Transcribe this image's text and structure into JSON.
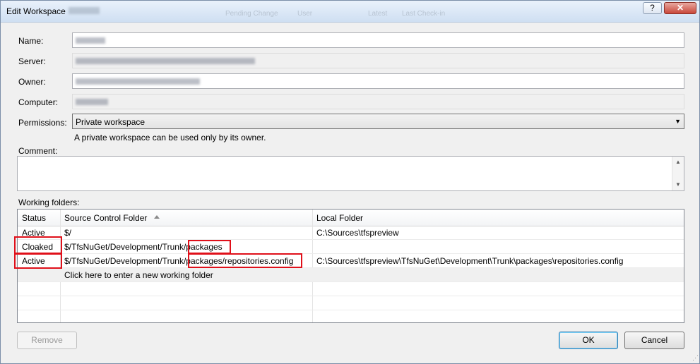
{
  "window": {
    "title": "Edit Workspace",
    "help_label": "?",
    "close_label": "✕",
    "bg_tabs": [
      "Pending Change",
      "User",
      "Latest",
      "Last Check-in"
    ]
  },
  "labels": {
    "name": "Name:",
    "server": "Server:",
    "owner": "Owner:",
    "computer": "Computer:",
    "permissions": "Permissions:",
    "comment": "Comment:",
    "working_folders": "Working folders:"
  },
  "permissions": {
    "value": "Private workspace",
    "hint": "A private workspace can be used only by its owner.",
    "arrow": "▼"
  },
  "grid": {
    "columns": [
      "Status",
      "Source Control Folder",
      "Local Folder"
    ],
    "rows": [
      {
        "status": "Active",
        "source_prefix": "$/",
        "source_suffix": "",
        "local": "C:\\Sources\\tfspreview"
      },
      {
        "status": "Cloaked",
        "source_prefix": "$/TfsNuGet/Development/Trunk/",
        "source_suffix": "packages",
        "local": ""
      },
      {
        "status": "Active",
        "source_prefix": "$/TfsNuGet/Development/Trunk/",
        "source_suffix": "packages/repositories.config",
        "local": "C:\\Sources\\tfspreview\\TfsNuGet\\Development\\Trunk\\packages\\repositories.config"
      }
    ],
    "new_row_text": "Click here to enter a new working folder"
  },
  "buttons": {
    "remove": "Remove",
    "ok": "OK",
    "cancel": "Cancel"
  },
  "icons": {
    "scroll_up": "▲",
    "scroll_down": "▼",
    "grip": "⋰"
  }
}
